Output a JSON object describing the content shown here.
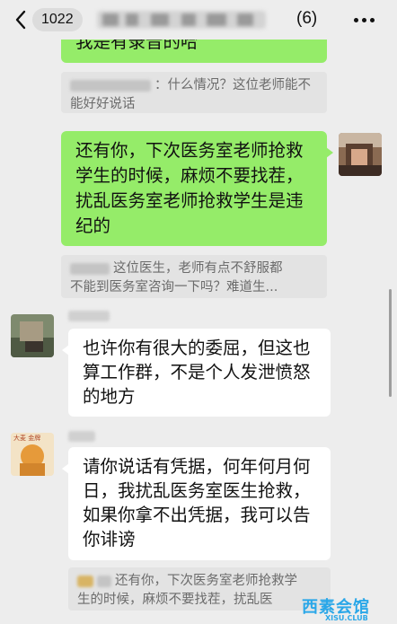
{
  "header": {
    "back_label": "1022",
    "member_count": "(6)"
  },
  "messages": [
    {
      "id": "green1_tail",
      "text": "我是有录音的哈"
    },
    {
      "id": "quote1",
      "text": "：什么情况？这位老师能不能好好说话"
    },
    {
      "id": "green2",
      "lines": [
        "还有你，下次医务室老师抢救",
        "学生的时候，麻烦不要找茬，",
        "扰乱医务室老师抢救学生是违",
        "纪的"
      ]
    },
    {
      "id": "quote2",
      "lines": [
        "这位医生，老师有点不舒服都",
        "不能到医务室咨询一下吗？难道生..."
      ]
    },
    {
      "id": "white1",
      "lines": [
        "也许你有很大的委屈，但这也",
        "算工作群，不是个人发泄愤怒",
        "的地方"
      ]
    },
    {
      "id": "white2",
      "lines": [
        "请你说话有凭据，何年何月何",
        "日，我扰乱医务室医生抢救，",
        "如果你拿不出凭据，我可以告",
        "你诽谤"
      ]
    },
    {
      "id": "quote3",
      "lines": [
        "还有你，下次医务室老师抢救学",
        "生的时候，麻烦不要找茬，扰乱医"
      ]
    }
  ],
  "avatar2_text": "大麦 金牌",
  "watermark": {
    "text": "西素会馆",
    "sub": "XISU.CLUB"
  },
  "colors": {
    "green_bubble": "#95ec69",
    "white_bubble": "#ffffff",
    "background": "#ededed",
    "quote_bg": "#e3e3e3"
  },
  "icons": [
    "chevron-left-icon",
    "more-dots-icon"
  ]
}
